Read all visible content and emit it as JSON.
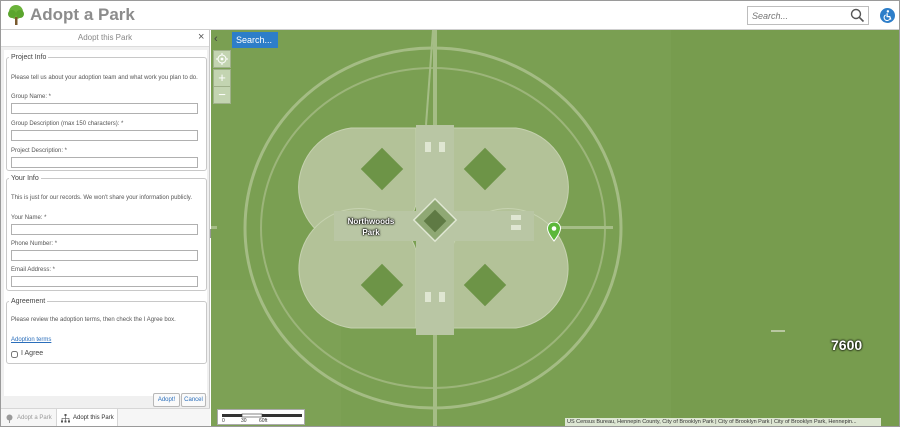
{
  "header": {
    "title": "Adopt a Park",
    "search_placeholder": "Search..."
  },
  "panel": {
    "title": "Adopt this Park",
    "close_label": "×",
    "project_info": {
      "legend": "Project Info",
      "hint": "Please tell us about your adoption team and what work you plan to do.",
      "group_name_label": "Group Name: *",
      "group_description_label": "Group Description (max 150 characters): *",
      "project_description_label": "Project Description: *"
    },
    "your_info": {
      "legend": "Your Info",
      "hint": "This is just for our records. We won't share your information publicly.",
      "name_label": "Your Name: *",
      "phone_label": "Phone Number: *",
      "email_label": "Email Address: *"
    },
    "agreement": {
      "legend": "Agreement",
      "hint": "Please review the adoption terms, then check the I Agree box.",
      "terms_link": "Adoption terms",
      "agree_label": "I Agree"
    },
    "buttons": {
      "adopt": "Adopt!",
      "cancel": "Cancel"
    },
    "tabs": [
      {
        "label": "Adopt a Park",
        "icon": "tree-icon",
        "active": false
      },
      {
        "label": "Adopt this Park",
        "icon": "hierarchy-icon",
        "active": true
      }
    ]
  },
  "map": {
    "search_button": "Search...",
    "collapse_label": "‹",
    "zoom_in": "+",
    "zoom_out": "−",
    "park_label_line1": "Northwoods",
    "park_label_line2": "Park",
    "overlay_number": "7600",
    "scale": {
      "labels": [
        "0",
        "30",
        "60ft"
      ]
    },
    "attribution": "US Census Bureau, Hennepin County, City of Brooklyn Park | City of Brooklyn Park | City of Brooklyn Park, Hennepin...",
    "colors": {
      "map_green": "#7a9f52",
      "accent_blue": "#2d7ec9",
      "marker_green": "#5cb83a"
    }
  }
}
